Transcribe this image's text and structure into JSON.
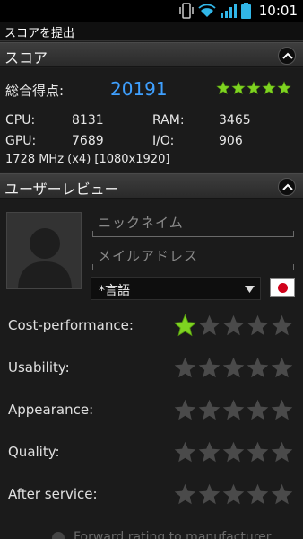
{
  "status_bar": {
    "time": "10:01"
  },
  "app_bar": {
    "title": "スコアを提出"
  },
  "score_section": {
    "header": "スコア",
    "total_label": "総合得点:",
    "total_value": "20191",
    "total_rating": 5,
    "specs": {
      "cpu_label": "CPU:",
      "cpu_value": "8131",
      "ram_label": "RAM:",
      "ram_value": "3465",
      "gpu_label": "GPU:",
      "gpu_value": "7689",
      "io_label": "I/O:",
      "io_value": "906",
      "device_line": "1728 MHz (x4) [1080x1920]"
    }
  },
  "review_section": {
    "header": "ユーザーレビュー",
    "nickname_placeholder": "ニックネイム",
    "email_placeholder": "メイルアドレス",
    "language_value": "*言語",
    "ratings": [
      {
        "label": "Cost-performance:",
        "value": 1
      },
      {
        "label": "Usability:",
        "value": 0
      },
      {
        "label": "Appearance:",
        "value": 0
      },
      {
        "label": "Quality:",
        "value": 0
      },
      {
        "label": "After service:",
        "value": 0
      }
    ],
    "forward_label": "Forward rating to manufacturer"
  },
  "colors": {
    "accent": "#3fa0ff",
    "star_on": "#7ed321",
    "star_off": "#4a4a4a"
  }
}
